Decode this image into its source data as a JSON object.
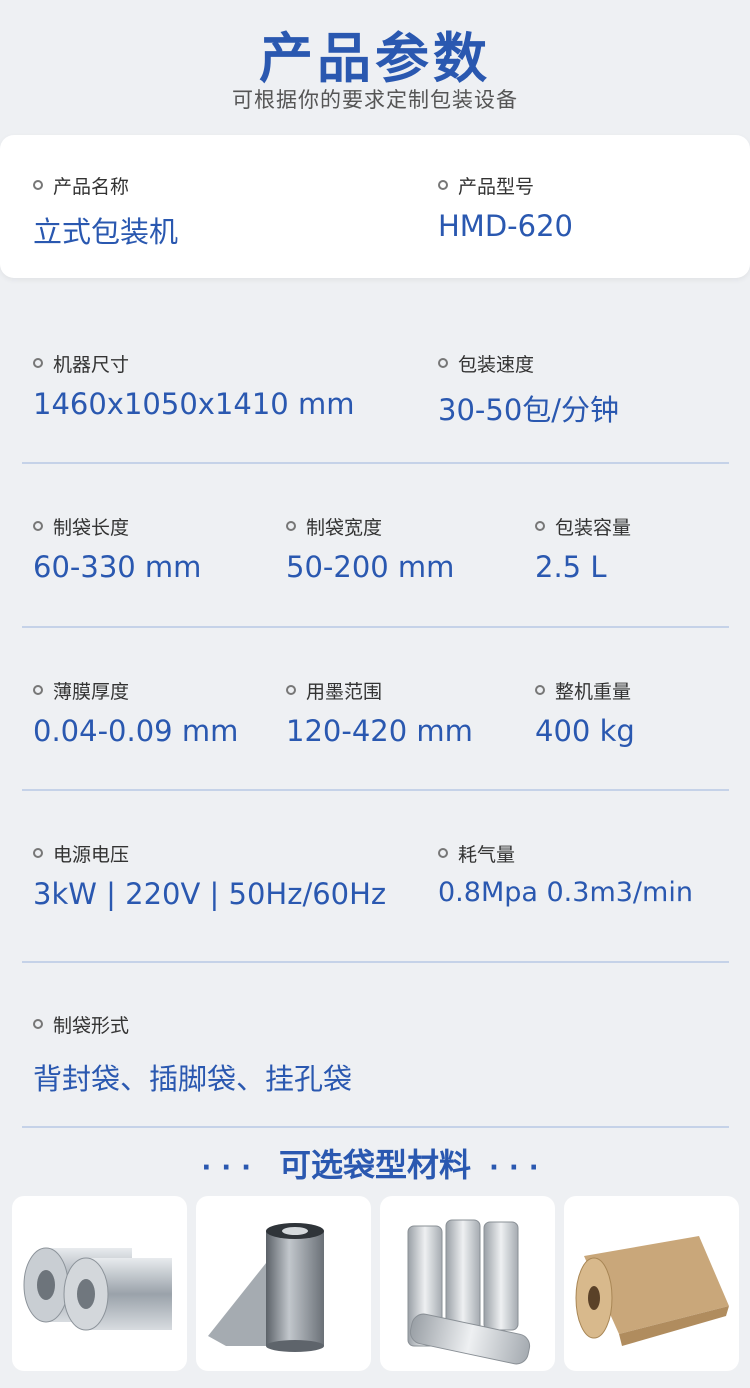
{
  "header": {
    "title": "产品参数",
    "subtitle": "可根据你的要求定制包装设备"
  },
  "specs": [
    {
      "label": "产品名称",
      "value": "立式包装机"
    },
    {
      "label": "产品型号",
      "value": "HMD-620"
    },
    {
      "label": "机器尺寸",
      "value": "1460x1050x1410 mm"
    },
    {
      "label": "包装速度",
      "value": "30-50包/分钟"
    },
    {
      "label": "制袋长度",
      "value": "60-330 mm"
    },
    {
      "label": "制袋宽度",
      "value": "50-200 mm"
    },
    {
      "label": "包装容量",
      "value": "2.5 L"
    },
    {
      "label": "薄膜厚度",
      "value": "0.04-0.09 mm"
    },
    {
      "label": "用墨范围",
      "value": "120-420 mm"
    },
    {
      "label": "整机重量",
      "value": "400 kg"
    },
    {
      "label": "电源电压",
      "value": "3kW | 220V | 50Hz/60Hz"
    },
    {
      "label": "耗气量",
      "value": "0.8Mpa 0.3m3/min"
    },
    {
      "label": "制袋形式",
      "value": "背封袋、插脚袋、挂孔袋"
    }
  ],
  "materials": {
    "dots": "···",
    "title": "可选袋型材料"
  },
  "colors": {
    "accent": "#2a58b0",
    "background": "#eef0f3",
    "divider": "#c5d2e8"
  }
}
